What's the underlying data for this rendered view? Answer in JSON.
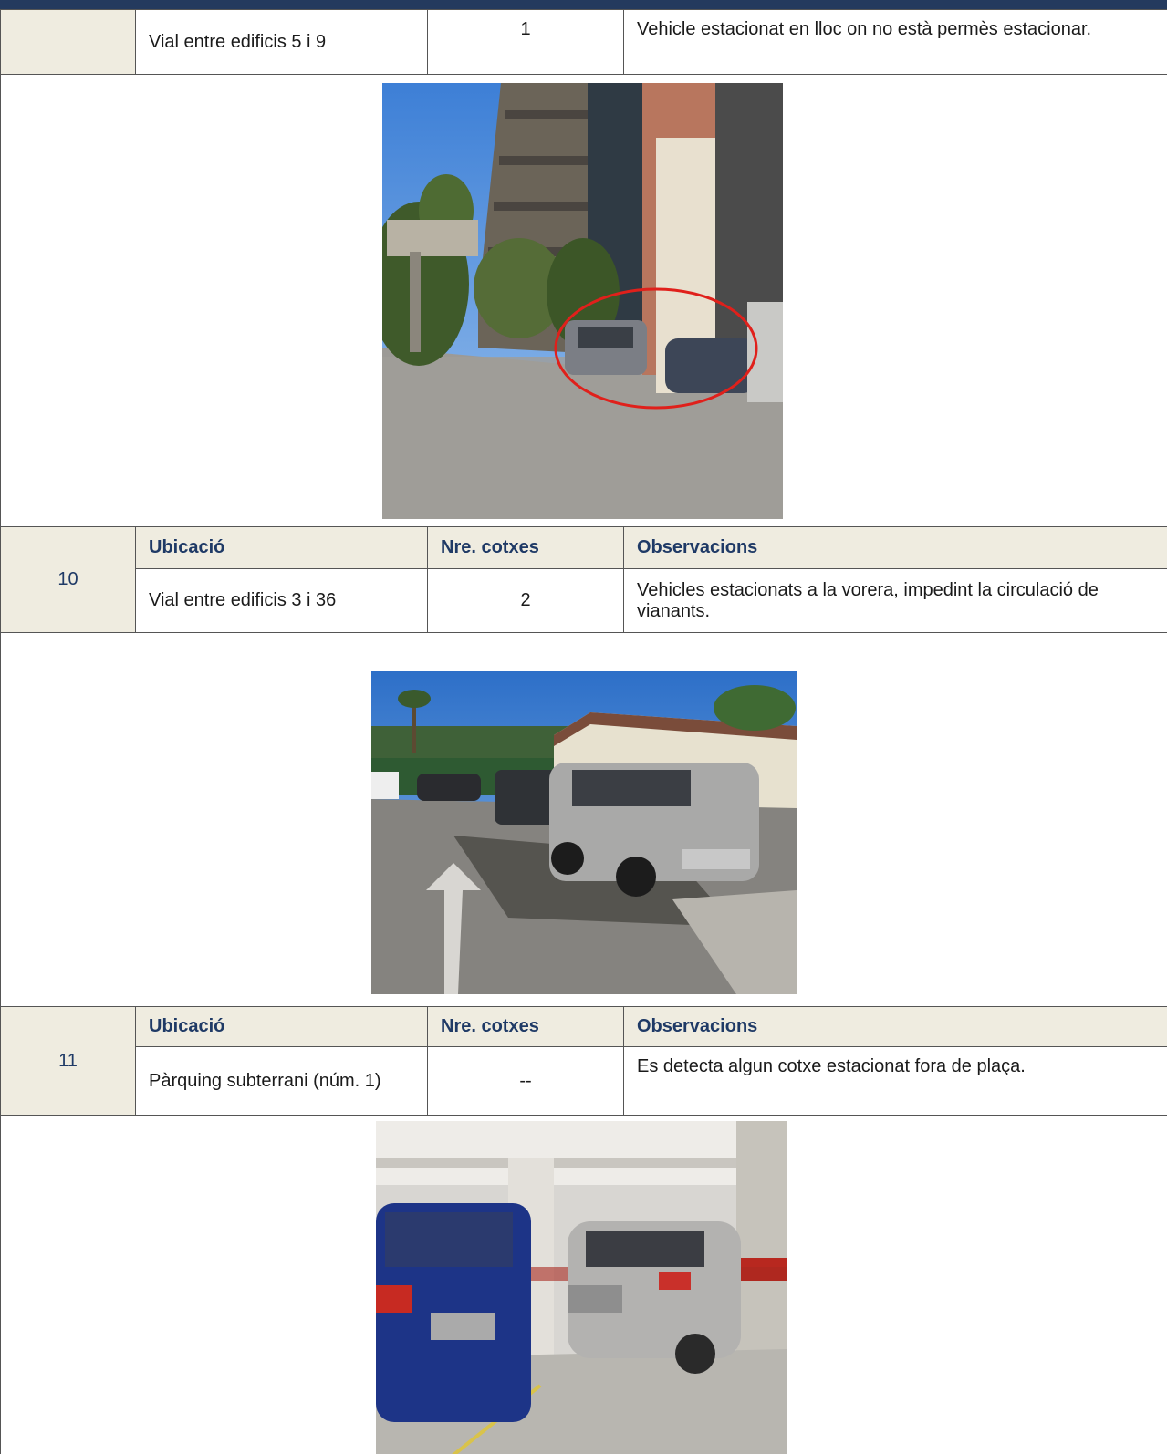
{
  "headers": {
    "ubicacio": "Ubicació",
    "cotxes": "Nre. cotxes",
    "observacions": "Observacions"
  },
  "entries": [
    {
      "number": "",
      "ubicacio": "Vial entre edificis 5 i 9",
      "cotxes": "1",
      "observacions": "Vehicle estacionat en lloc on no està permès estacionar.",
      "photo": "photo-building-parked-car-circled"
    },
    {
      "number": "10",
      "ubicacio": "Vial entre edificis 3 i 36",
      "cotxes": "2",
      "observacions": "Vehicles estacionats a la vorera, impedint la circulació de vianants.",
      "photo": "photo-suv-on-sidewalk"
    },
    {
      "number": "11",
      "ubicacio": "Pàrquing subterrani (núm. 1)",
      "cotxes": "--",
      "observacions": "Es detecta algun cotxe estacionat fora de plaça.",
      "photo": "photo-underground-parking"
    }
  ],
  "colors": {
    "header_bar": "#243a5e",
    "header_bg": "#efece0",
    "header_text": "#1f3a66",
    "highlight_circle": "#e0201b"
  }
}
